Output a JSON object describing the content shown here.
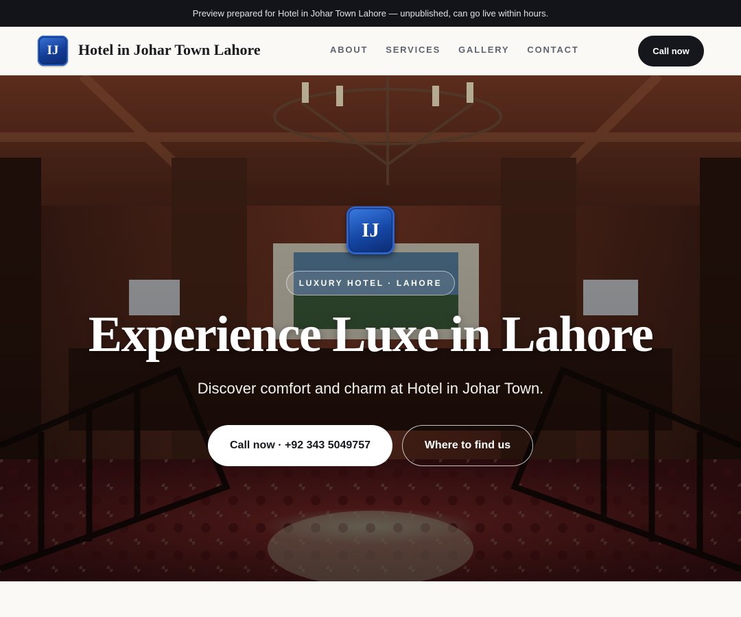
{
  "preview_bar": {
    "text": "Preview prepared for Hotel in Johar Town Lahore — unpublished, can go live within hours."
  },
  "header": {
    "logo_text": "IJ",
    "brand_name": "Hotel in Johar Town Lahore",
    "nav": [
      {
        "label": "ABOUT"
      },
      {
        "label": "SERVICES"
      },
      {
        "label": "GALLERY"
      },
      {
        "label": "CONTACT"
      }
    ],
    "call_label": "Call now"
  },
  "hero": {
    "logo_text": "IJ",
    "badge": "LUXURY HOTEL · LAHORE",
    "title": "Experience Luxe in Lahore",
    "subtitle": "Discover comfort and charm at Hotel in Johar Town.",
    "primary_button": "Call now · +92 343 5049757",
    "secondary_button": "Where to find us",
    "background_image": "hotel-lobby-photo"
  },
  "colors": {
    "top_bar": "#121419",
    "page_bg": "#faf9f5",
    "dark_button": "#15171c",
    "logo_blue": "#1446a3",
    "nav_text": "#5e6470"
  }
}
